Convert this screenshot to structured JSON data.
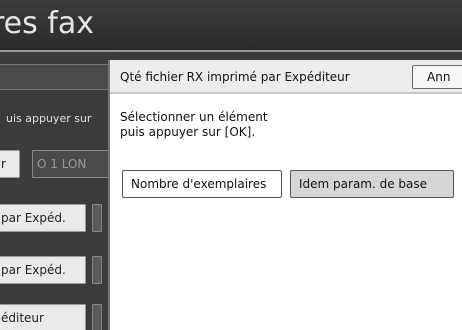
{
  "titlebar": {
    "title": "res fax"
  },
  "background_panel": {
    "instruction": "uis appuyer sur",
    "buttons": [
      "r",
      "O 1 LON",
      "par Expéd.",
      "par Expéd.",
      "éditeur"
    ]
  },
  "dialog": {
    "title": "Qté fichier RX imprimé par Expéditeur",
    "cancel_label": "Ann",
    "prompt": "Sélectionner un élément\npuis appuyer sur [OK].",
    "options": [
      {
        "label": "Nombre d'exemplaires",
        "selected": false
      },
      {
        "label": "Idem param. de base",
        "selected": true
      }
    ]
  },
  "colors": {
    "title_bar_bg": "#333333",
    "panel_bg": "#3b3b3b",
    "dialog_bg": "#ffffff",
    "selected_option_bg": "#d6d6d6"
  }
}
